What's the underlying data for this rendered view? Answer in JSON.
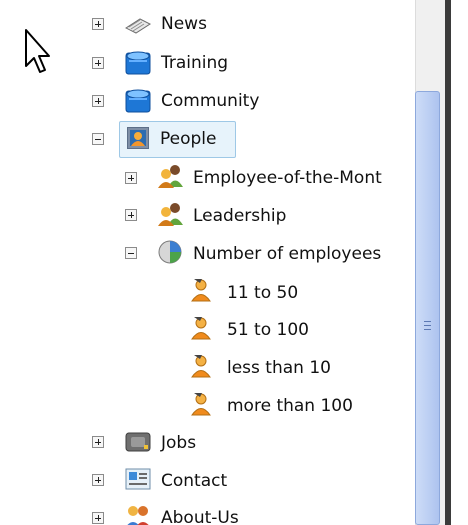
{
  "tree": {
    "items": [
      {
        "label": "News",
        "icon": "newspaper-icon",
        "expander": "+"
      },
      {
        "label": "Training",
        "icon": "folder-icon",
        "expander": "+"
      },
      {
        "label": "Community",
        "icon": "folder-icon",
        "expander": "+"
      },
      {
        "label": "People",
        "icon": "person-picture-icon",
        "expander": "-",
        "selected": true
      },
      {
        "label": "Employee-of-the-Mont",
        "icon": "users-group-icon",
        "expander": "+"
      },
      {
        "label": "Leadership",
        "icon": "users-group-icon",
        "expander": "+"
      },
      {
        "label": "Number of employees",
        "icon": "pie-chart-icon",
        "expander": "-"
      },
      {
        "label": "11 to 50",
        "icon": "person-leaf-icon"
      },
      {
        "label": "51 to 100",
        "icon": "person-leaf-icon"
      },
      {
        "label": "less than 10",
        "icon": "person-leaf-icon"
      },
      {
        "label": "more than 100",
        "icon": "person-leaf-icon"
      },
      {
        "label": "Jobs",
        "icon": "briefcase-icon",
        "expander": "+"
      },
      {
        "label": "Contact",
        "icon": "contact-card-icon",
        "expander": "+"
      },
      {
        "label": "About-Us",
        "icon": "users-about-icon",
        "expander": "+"
      }
    ]
  },
  "colors": {
    "selection_background": "#e7f3fb",
    "selection_border": "#9ec8e6",
    "scrollbar_thumb": "#bccff3"
  }
}
